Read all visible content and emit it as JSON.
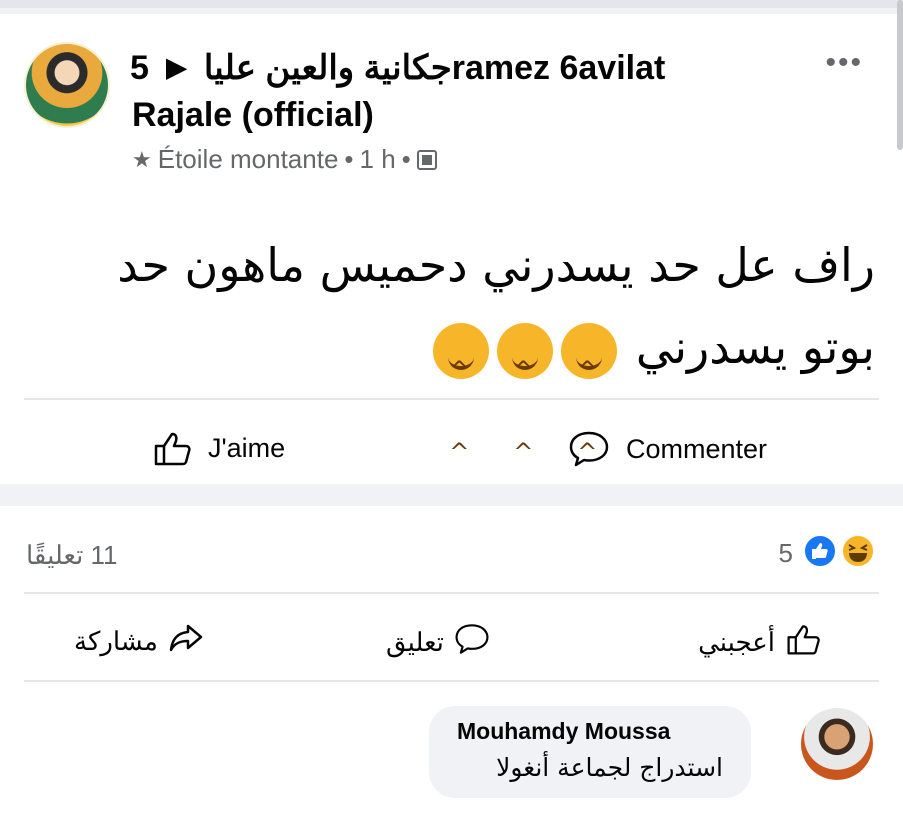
{
  "post": {
    "group_name": "جكانية والعين عليا",
    "separator_arrow": "▶",
    "author_line1": "5ramez 6avilat",
    "author_line2": "Rajale (official)",
    "badge_label": "Étoile montante",
    "meta_separator": "•",
    "time": "1 h",
    "more_label": "•••",
    "text_line1": "راف عل حد يسدرني دحميس ماهون حد",
    "text_line2": "بوتو يسدرني",
    "emoji_count": 3
  },
  "post_actions": {
    "like_label": "J'aime",
    "comment_label": "Commenter"
  },
  "stats": {
    "comments_count": "11 تعليقًا",
    "reactions_count": "5"
  },
  "actions_ar": {
    "like_label": "أعجبني",
    "comment_label": "تعليق",
    "share_label": "مشاركة"
  },
  "comment": {
    "author": "Mouhamdy Moussa",
    "text": "استدراج لجماعة أنغولا"
  },
  "colors": {
    "accent_blue": "#1877f2",
    "emoji_yellow": "#f7b529",
    "secondary_text": "#65676b",
    "bubble_bg": "#f0f2f5"
  }
}
